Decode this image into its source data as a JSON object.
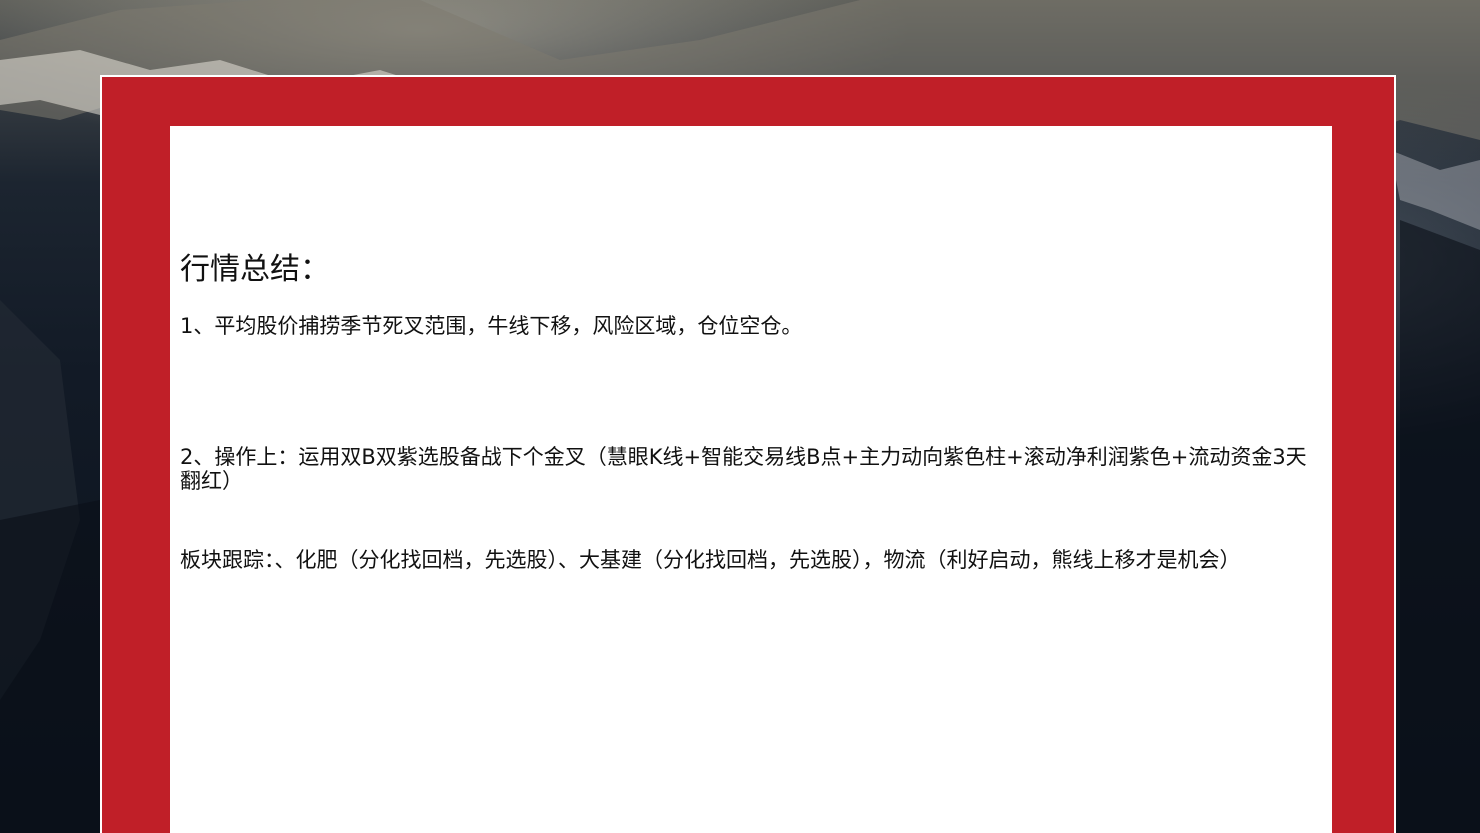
{
  "document": {
    "heading": "行情总结：",
    "paragraphs": [
      "1、平均股价捕捞季节死叉范围，牛线下移，风险区域，仓位空仓。",
      "2、操作上：运用双B双紫选股备战下个金叉（慧眼K线+智能交易线B点+主力动向紫色柱+滚动净利润紫色+流动资金3天翻红）",
      "板块跟踪：、化肥（分化找回档，先选股）、大基建（分化找回档，先选股），物流（利好启动，熊线上移才是机会）"
    ]
  },
  "colors": {
    "frame": "#c01f28",
    "frame_border": "#ffffff",
    "paper": "#ffffff",
    "text": "#111111"
  }
}
